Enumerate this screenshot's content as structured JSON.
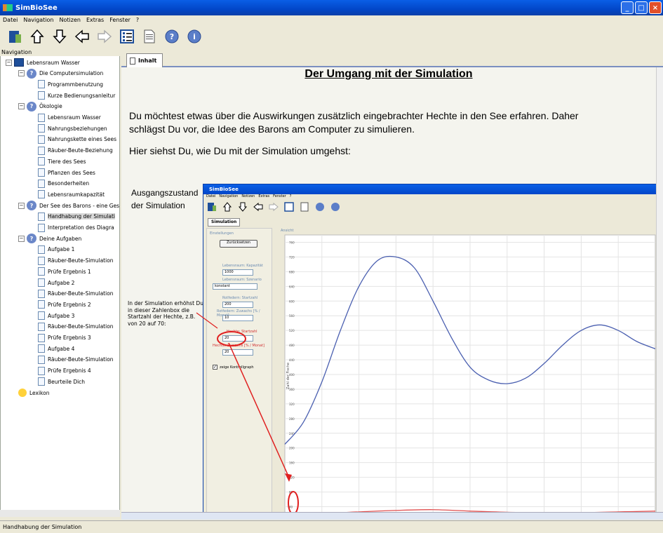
{
  "window": {
    "title": "SimBioSee"
  },
  "menu": [
    "Datei",
    "Navigation",
    "Notizen",
    "Extras",
    "Fenster",
    "?"
  ],
  "toolbar_icons": [
    "book-icon",
    "arrow-up-icon",
    "arrow-down-icon",
    "arrow-left-icon",
    "arrow-right-icon",
    "list-view-icon",
    "page-icon",
    "help-icon",
    "info-icon"
  ],
  "nav": {
    "label": "Navigation",
    "items": [
      {
        "label": "Lebensraum Wasser",
        "level": 0,
        "icon": "book",
        "exp": "−"
      },
      {
        "label": "Die Computersimulation",
        "level": 1,
        "icon": "q",
        "exp": "−"
      },
      {
        "label": "Programmbenutzung",
        "level": 2,
        "icon": "doc"
      },
      {
        "label": "Kurze Bedienungsanleitur",
        "level": 2,
        "icon": "doc"
      },
      {
        "label": "Ökologie",
        "level": 1,
        "icon": "q",
        "exp": "−"
      },
      {
        "label": "Lebensraum Wasser",
        "level": 2,
        "icon": "doc"
      },
      {
        "label": "Nahrungsbeziehungen",
        "level": 2,
        "icon": "doc"
      },
      {
        "label": "Nahrungskette eines Sees",
        "level": 2,
        "icon": "doc"
      },
      {
        "label": "Räuber-Beute-Beziehung",
        "level": 2,
        "icon": "doc"
      },
      {
        "label": "Tiere des Sees",
        "level": 2,
        "icon": "doc"
      },
      {
        "label": "Pflanzen des Sees",
        "level": 2,
        "icon": "doc"
      },
      {
        "label": "Besonderheiten",
        "level": 2,
        "icon": "doc"
      },
      {
        "label": "Lebensraumkapazität",
        "level": 2,
        "icon": "doc"
      },
      {
        "label": "Der See des Barons - eine Ges",
        "level": 1,
        "icon": "q",
        "exp": "−"
      },
      {
        "label": "Handhabung der Simulati",
        "level": 2,
        "icon": "doc",
        "selected": true
      },
      {
        "label": "Interpretation des Diagra",
        "level": 2,
        "icon": "doc"
      },
      {
        "label": "Deine Aufgaben",
        "level": 1,
        "icon": "q",
        "exp": "−"
      },
      {
        "label": "Aufgabe 1",
        "level": 2,
        "icon": "doc"
      },
      {
        "label": "Räuber-Beute-Simulation",
        "level": 2,
        "icon": "doc"
      },
      {
        "label": "Prüfe Ergebnis 1",
        "level": 2,
        "icon": "doc"
      },
      {
        "label": "Aufgabe 2",
        "level": 2,
        "icon": "doc"
      },
      {
        "label": "Räuber-Beute-Simulation",
        "level": 2,
        "icon": "doc"
      },
      {
        "label": "Prüfe Ergebnis 2",
        "level": 2,
        "icon": "doc"
      },
      {
        "label": "Aufgabe 3",
        "level": 2,
        "icon": "doc"
      },
      {
        "label": "Räuber-Beute-Simulation",
        "level": 2,
        "icon": "doc"
      },
      {
        "label": "Prüfe Ergebnis 3",
        "level": 2,
        "icon": "doc"
      },
      {
        "label": "Aufgabe 4",
        "level": 2,
        "icon": "doc"
      },
      {
        "label": "Räuber-Beute-Simulation",
        "level": 2,
        "icon": "doc"
      },
      {
        "label": "Prüfe Ergebnis 4",
        "level": 2,
        "icon": "doc"
      },
      {
        "label": "Beurteile Dich",
        "level": 2,
        "icon": "doc"
      },
      {
        "label": "Lexikon",
        "level": 1,
        "icon": "bulb"
      }
    ]
  },
  "tab": {
    "label": "Inhalt"
  },
  "content": {
    "title": "Der Umgang mit der Simulation",
    "para1_line1": "Du möchtest etwas über die Auswirkungen zusätzlich eingebrachter Hechte in den See erfahren. Daher",
    "para1_line2": "schlägst Du vor, die Idee des Barons am Computer zu simulieren.",
    "para2": "Hier siehst Du, wie Du mit der Simulation umgehst:",
    "label_line1": "Ausgangszustand",
    "label_line2": "der Simulation",
    "annotation": "In der Simulation erhöhst Du in dieser Zahlenbox die Startzahl der Hechte, z.B. von 20 auf 70:"
  },
  "inner_app": {
    "title": "SimBioSee",
    "menu": [
      "Datei",
      "Navigation",
      "Notizen",
      "Extras",
      "Fenster",
      "?"
    ],
    "tab": "Simulation",
    "settings": {
      "heading": "Einstellungen",
      "start_button": "Zurücksetzen",
      "capacity_label": "Lebensraum: Kapazität",
      "capacity_value": "1000",
      "scenario_label": "Lebensraum: Szenario",
      "scenario_value": "konstant",
      "carp_start_label": "Rotfedern: Startzahl",
      "carp_start_value": "200",
      "carp_growth_label": "Rotfedern: Zuwachs [% / Monat]",
      "carp_growth_value": "10",
      "pike_start_label": "Hechte: Startzahl",
      "pike_start_value": "20",
      "pike_growth_label": "Hechte: Zuwachs [% / Monat]",
      "pike_growth_value": "20",
      "checkbox_label": "zeige Kontrollgraph"
    },
    "chart_heading": "Ansicht"
  },
  "chart_data": {
    "type": "line",
    "ylabel": "Zahl der Fische",
    "yticks": [
      760,
      720,
      680,
      640,
      600,
      560,
      520,
      480,
      440,
      400,
      360,
      320,
      280,
      240,
      200,
      160,
      120,
      80,
      40
    ],
    "ylim": [
      20,
      780
    ],
    "xlim": [
      0,
      10
    ],
    "series": [
      {
        "color": "#4a5fb0",
        "x": [
          0,
          0.5,
          1,
          1.5,
          2,
          2.5,
          3,
          3.5,
          4,
          4.5,
          5,
          5.5,
          6,
          6.5,
          7,
          7.5,
          8,
          8.5,
          9,
          9.5,
          10
        ],
        "y": [
          210,
          270,
          380,
          520,
          640,
          710,
          720,
          690,
          600,
          500,
          420,
          385,
          375,
          390,
          430,
          480,
          520,
          535,
          520,
          490,
          470
        ]
      },
      {
        "color": "#e05050",
        "x": [
          0,
          1,
          2,
          3,
          4,
          5,
          6,
          7,
          8,
          9,
          10
        ],
        "y": [
          20,
          22,
          26,
          30,
          32,
          28,
          25,
          24,
          24,
          26,
          28
        ]
      }
    ]
  },
  "status": "Handhabung der Simulation"
}
